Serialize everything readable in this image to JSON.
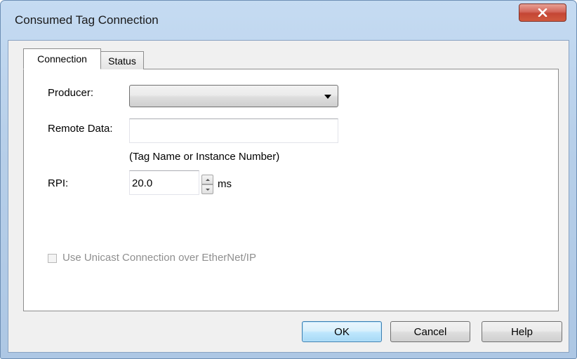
{
  "window": {
    "title": "Consumed Tag Connection",
    "close_label": "X"
  },
  "tabs": [
    {
      "label": "Connection",
      "active": true
    },
    {
      "label": "Status",
      "active": false
    }
  ],
  "form": {
    "producer_label": "Producer:",
    "producer_value": "",
    "remote_data_label": "Remote Data:",
    "remote_data_value": "",
    "remote_data_hint": "(Tag Name or Instance Number)",
    "rpi_label": "RPI:",
    "rpi_value": "20.0",
    "rpi_unit": "ms",
    "unicast_label": "Use Unicast Connection over EtherNet/IP",
    "unicast_checked": false,
    "unicast_enabled": false
  },
  "buttons": {
    "ok": "OK",
    "cancel": "Cancel",
    "help": "Help"
  },
  "icons": {
    "close": "close-icon",
    "dropdown": "chevron-down-icon",
    "spin_up": "arrow-up-icon",
    "spin_down": "arrow-down-icon"
  },
  "colors": {
    "titlebar": "#b7cfe9",
    "close_button": "#c44634",
    "default_button_border": "#3c7fb1",
    "disabled_text": "#8f8f8f"
  }
}
